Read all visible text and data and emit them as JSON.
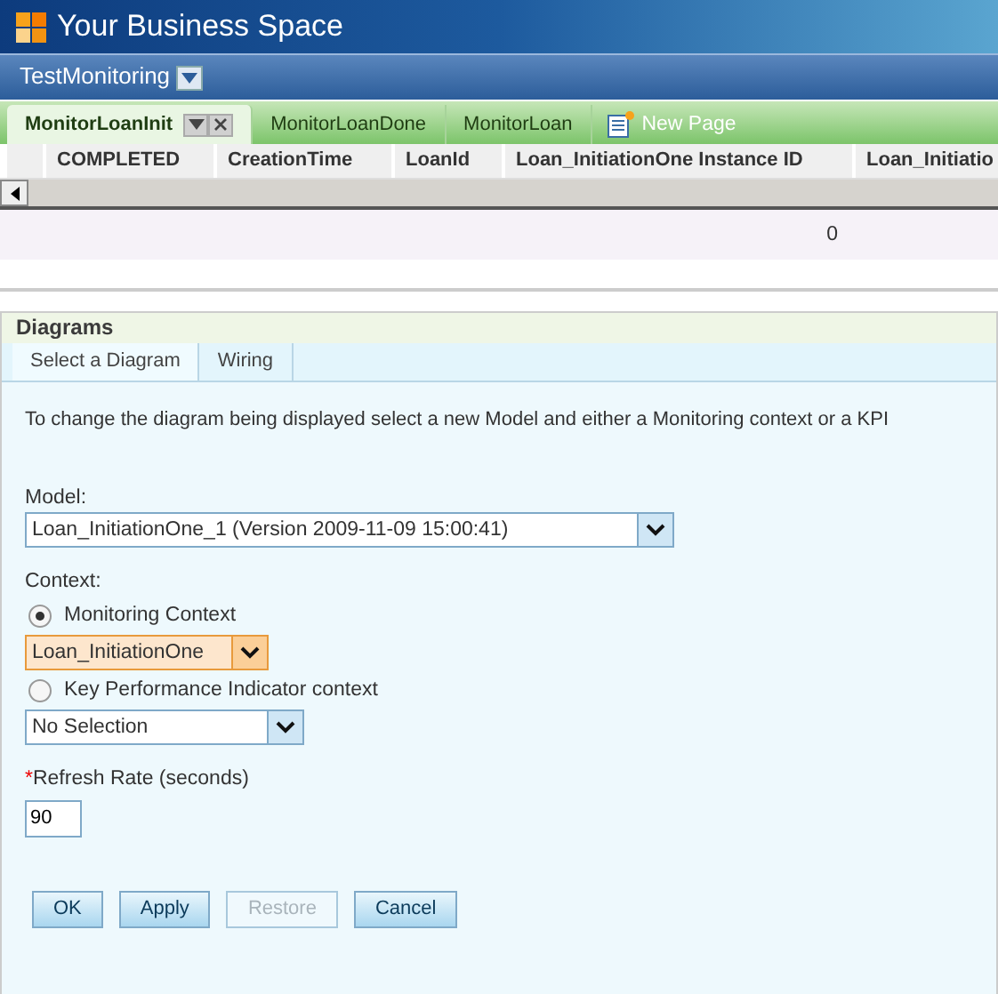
{
  "app": {
    "title": "Your Business Space"
  },
  "space": {
    "name": "TestMonitoring"
  },
  "page_tabs": [
    {
      "label": "MonitorLoanInit",
      "selected": true
    },
    {
      "label": "MonitorLoanDone",
      "selected": false
    },
    {
      "label": "MonitorLoan",
      "selected": false
    }
  ],
  "new_page": {
    "label": "New Page"
  },
  "table": {
    "columns": [
      "COMPLETED",
      "CreationTime",
      "LoanId",
      "Loan_InitiationOne Instance ID",
      "Loan_Initiatio"
    ],
    "rows": [
      {
        "column_4": "0"
      }
    ]
  },
  "diagrams": {
    "title": "Diagrams",
    "tabs": [
      {
        "label": "Select a Diagram",
        "selected": true
      },
      {
        "label": "Wiring",
        "selected": false
      }
    ],
    "description": "To change the diagram being displayed select a new Model and either a Monitoring context or a KPI",
    "model": {
      "label": "Model:",
      "value": "Loan_InitiationOne_1 (Version 2009-11-09 15:00:41)"
    },
    "context_label": "Context:",
    "contexts": [
      {
        "label": "Monitoring Context",
        "selected": true,
        "value": "Loan_InitiationOne"
      },
      {
        "label": "Key Performance Indicator context",
        "selected": false,
        "value": "No Selection"
      }
    ],
    "refresh": {
      "required_marker": "*",
      "label": "Refresh Rate (seconds)",
      "value": "90"
    },
    "buttons": [
      {
        "label": "OK",
        "disabled": false
      },
      {
        "label": "Apply",
        "disabled": false
      },
      {
        "label": "Restore",
        "disabled": true
      },
      {
        "label": "Cancel",
        "disabled": false
      }
    ]
  }
}
